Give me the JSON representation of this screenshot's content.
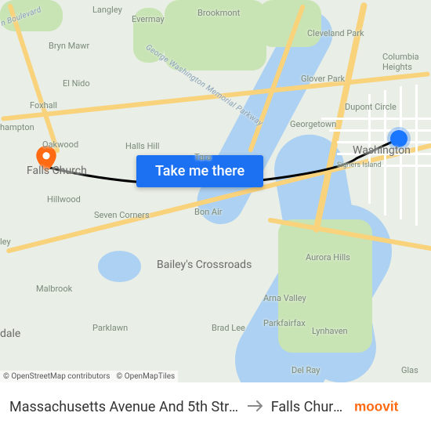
{
  "cta": {
    "label": "Take me there"
  },
  "route": {
    "origin_label": "Massachusetts Avenue And 5th Stre…",
    "destination_label": "Falls Churc…",
    "origin_marker_color": "#1976ff",
    "dest_marker_color": "#ff6a13"
  },
  "attribution": {
    "osm": "© OpenStreetMap contributors",
    "omt": "© OpenMapTiles"
  },
  "brand": {
    "name": "moovit",
    "color": "#ff6a13"
  },
  "labels": {
    "langley": "Langley",
    "evermay": "Evermay",
    "brookmont": "Brookmont",
    "bryn_mawr": "Bryn Mawr",
    "el_nido": "El Nido",
    "foxhall": "Foxhall",
    "hampton": "hampton",
    "oakwood": "Oakwood",
    "halls_hill": "Halls Hill",
    "tara": "Tara",
    "falls_church": "Falls Church",
    "hillwood": "Hillwood",
    "seven_corners": "Seven Corners",
    "ley": "ley",
    "malbrook": "Malbrook",
    "dale": "dale",
    "parklawn": "Parklawn",
    "bon_air": "Bon Air",
    "baileys": "Bailey's Crossroads",
    "brad_lee": "Brad Lee",
    "parkfairfax": "Parkfairfax",
    "arna_valley": "Arna Valley",
    "del_ray": "Del Ray",
    "lynhaven": "Lynhaven",
    "aurora_hills": "Aurora Hills",
    "glas": "Glas",
    "georgetown": "Georgetown",
    "washington": "Washington",
    "signers": "Signers Island",
    "dupont": "Dupont Circle",
    "columbia": "Columbia Heights",
    "glover": "Glover Park",
    "cleveland": "Cleveland Park",
    "gw_pkwy": "George Washington Memorial Parkway",
    "n_blvd": "n Boulevard"
  }
}
